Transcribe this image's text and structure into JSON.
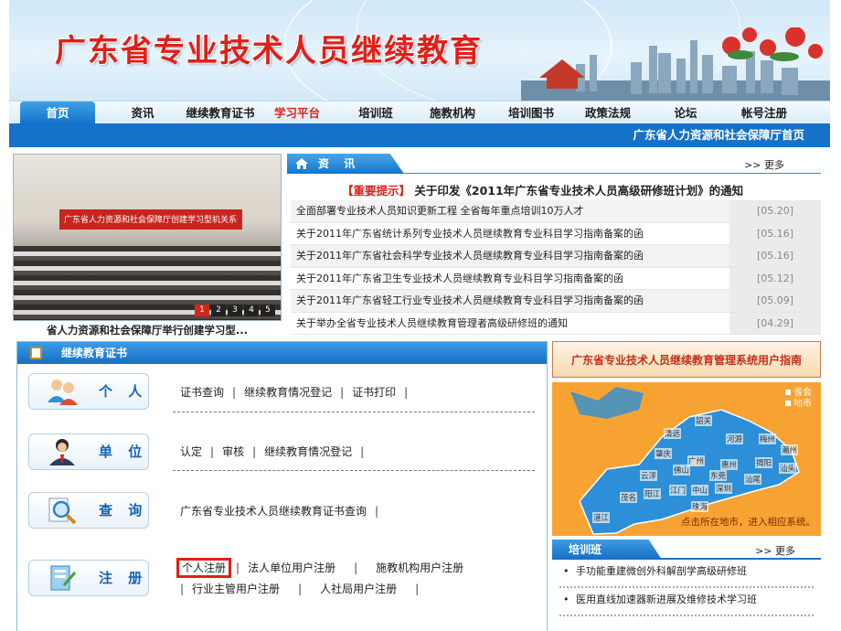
{
  "header": {
    "title": "广东省专业技术人员继续教育"
  },
  "nav": {
    "items": [
      "首页",
      "资讯",
      "继续教育证书",
      "学习平台",
      "培训班",
      "施教机构",
      "培训图书",
      "政策法规",
      "论坛",
      "帐号注册"
    ],
    "active_index": 0,
    "highlight_index": 3,
    "sub_link": "广东省人力资源和社会保障厅首页"
  },
  "photo": {
    "banner_text": "广东省人力资源和社会保障厅创建学习型机关系列讲座",
    "pages": [
      "1",
      "2",
      "3",
      "4",
      "5"
    ],
    "active_page": "1",
    "caption": "省人力资源和社会保障厅举行创建学习型..."
  },
  "news": {
    "tab_label": "资 讯",
    "more": ">> 更多",
    "notice_tag": "【重要提示】",
    "notice_text": "关于印发《2011年广东省专业技术人员高级研修班计划》的通知",
    "items": [
      {
        "title": "全面部署专业技术人员知识更新工程 全省每年重点培训10万人才",
        "date": "[05.20]"
      },
      {
        "title": "关于2011年广东省统计系列专业技术人员继续教育专业科目学习指南备案的函",
        "date": "[05.16]"
      },
      {
        "title": "关于2011年广东省社会科学专业技术人员继续教育专业科目学习指南备案的函",
        "date": "[05.16]"
      },
      {
        "title": "关于2011年广东省卫生专业技术人员继续教育专业科目学习指南备案的函",
        "date": "[05.12]"
      },
      {
        "title": "关于2011年广东省轻工行业专业技术人员继续教育专业科目学习指南备案的函",
        "date": "[05.09]"
      },
      {
        "title": "关于举办全省专业技术人员继续教育管理者高级研修班的通知",
        "date": "[04.29]"
      }
    ]
  },
  "cert": {
    "title": "继续教育证书",
    "personal": {
      "label": "个 人",
      "links": [
        "证书查询",
        "继续教育情况登记",
        "证书打印"
      ]
    },
    "unit": {
      "label": "单 位",
      "links": [
        "认定",
        "审核",
        "继续教育情况登记"
      ]
    },
    "query": {
      "label": "查 询",
      "links": [
        "广东省专业技术人员继续教育证书查询"
      ]
    },
    "register": {
      "label": "注 册",
      "links": [
        "个人注册",
        "法人单位用户注册",
        "施教机构用户注册",
        "行业主管用户注册",
        "人社局用户注册"
      ]
    },
    "separator": "|"
  },
  "guide": {
    "text": "广东省专业技术人员继续教育管理系统用户指南"
  },
  "map": {
    "legend_capital": "省会",
    "legend_city": "地市",
    "hint": "点击所在地市，进入相应系统。",
    "cities": [
      "韶关",
      "清远",
      "河源",
      "梅州",
      "潮州",
      "揭阳",
      "汕头",
      "汕尾",
      "惠州",
      "广州",
      "肇庆",
      "佛山",
      "东莞",
      "深圳",
      "云浮",
      "江门",
      "中山",
      "珠海",
      "阳江",
      "茂名",
      "湛江"
    ]
  },
  "training": {
    "title": "培训班",
    "more": ">> 更多",
    "items": [
      "手功能重建微创外科解剖学高级研修班",
      "医用直线加速器新进展及维修技术学习班"
    ]
  },
  "colors": {
    "brand_blue": "#1572c8",
    "accent_red": "#e0201a",
    "map_orange": "#f7a334"
  }
}
